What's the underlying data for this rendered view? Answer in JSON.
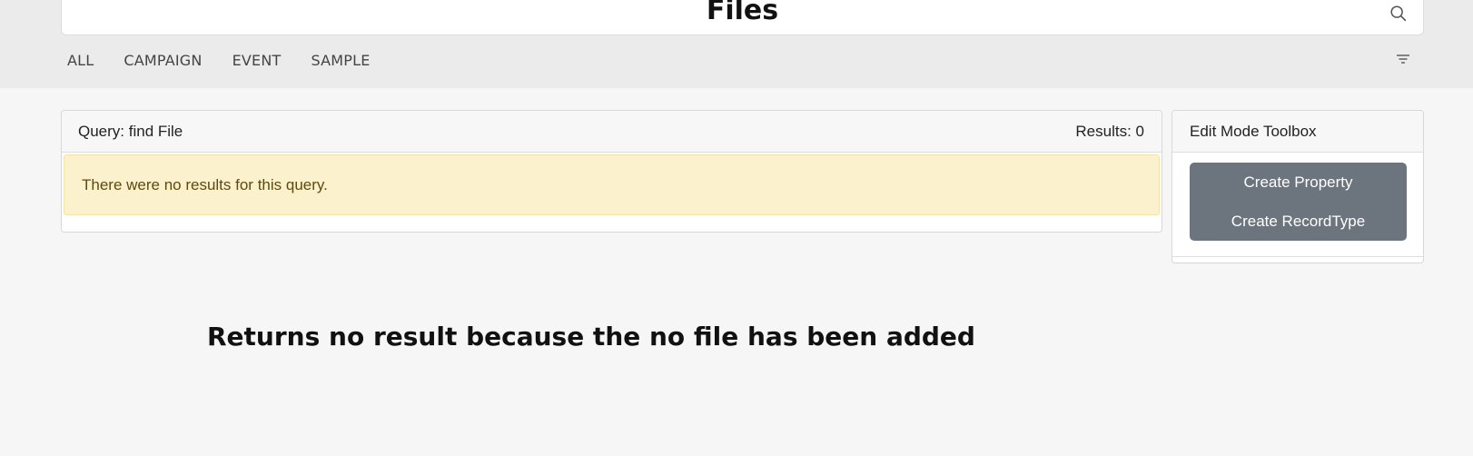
{
  "header": {
    "title": "Files",
    "search_icon": "search-icon"
  },
  "tabs": [
    "ALL",
    "CAMPAIGN",
    "EVENT",
    "SAMPLE"
  ],
  "filter_icon": "filter-icon",
  "query": {
    "label": "Query: find File",
    "results": "Results: 0",
    "alert": "There were no results for this query.",
    "alert_color": "#fcf1cd"
  },
  "toolbox": {
    "title": "Edit Mode Toolbox",
    "buttons": [
      "Create Property",
      "Create RecordType"
    ],
    "button_color": "#6c757d"
  },
  "caption": "Returns no result because the no file has been added"
}
